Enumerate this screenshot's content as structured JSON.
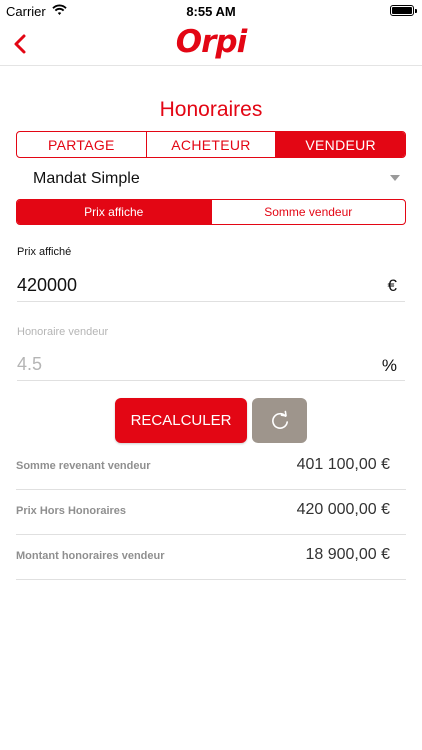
{
  "status_bar": {
    "carrier": "Carrier",
    "time": "8:55 AM"
  },
  "navbar": {
    "logo": "Orpi",
    "back_icon": "chevron-left-icon"
  },
  "title": "Honoraires",
  "tabs_top": [
    {
      "label": "PARTAGE",
      "active": false
    },
    {
      "label": "ACHETEUR",
      "active": false
    },
    {
      "label": "VENDEUR",
      "active": true
    }
  ],
  "mandat": {
    "selected": "Mandat Simple"
  },
  "tabs_mode": [
    {
      "label": "Prix affiche",
      "active": true
    },
    {
      "label": "Somme vendeur",
      "active": false
    }
  ],
  "prix_affiche": {
    "label": "Prix affiché",
    "value": "420000",
    "unit": "€"
  },
  "honoraire": {
    "label": "Honoraire vendeur",
    "placeholder": "4.5",
    "unit": "%"
  },
  "buttons": {
    "recalculer": "RECALCULER",
    "reset_icon": "refresh-icon"
  },
  "results": [
    {
      "label": "Somme revenant vendeur",
      "value": "401 100,00 €"
    },
    {
      "label": "Prix Hors Honoraires",
      "value": "420 000,00 €"
    },
    {
      "label": "Montant honoraires vendeur",
      "value": "18 900,00 €"
    }
  ],
  "colors": {
    "accent": "#e30614",
    "reset_button": "#9e958c",
    "muted_text": "#8f8f8f"
  }
}
